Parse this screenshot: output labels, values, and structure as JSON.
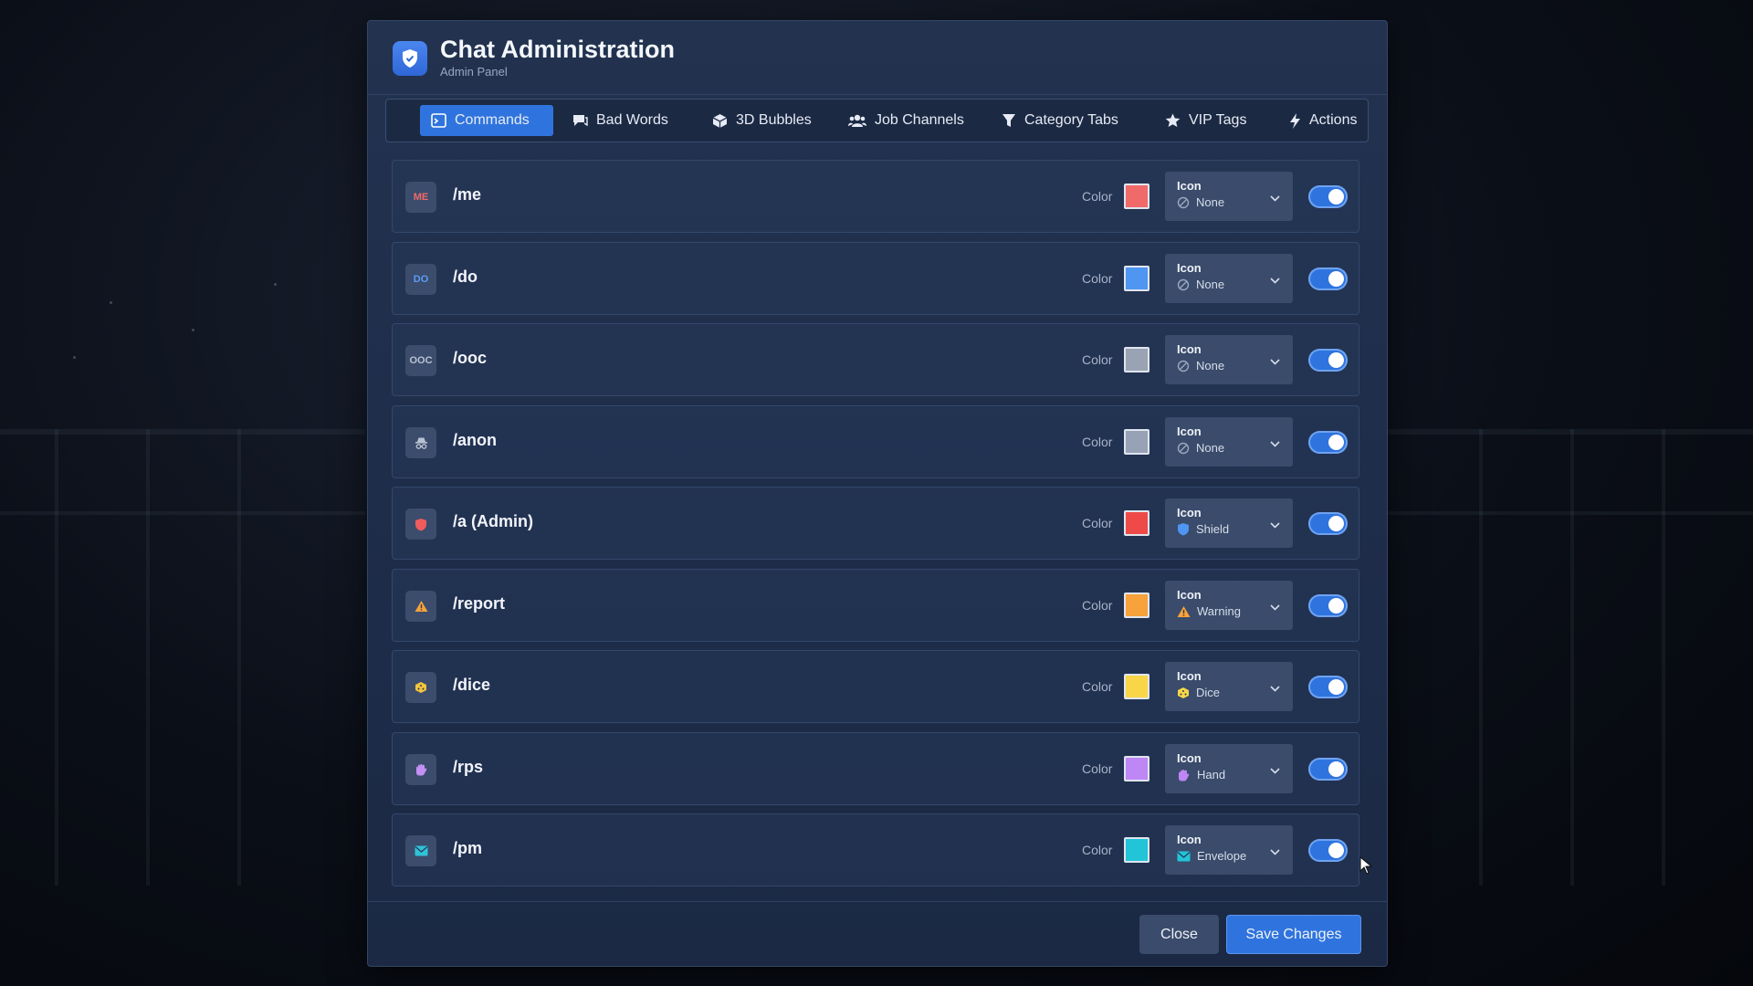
{
  "header": {
    "title": "Chat Administration",
    "subtitle": "Admin Panel"
  },
  "tabs": [
    {
      "label": "Commands",
      "icon": "terminal-icon",
      "active": true
    },
    {
      "label": "Bad Words",
      "icon": "chat-bubble-icon",
      "active": false
    },
    {
      "label": "3D Bubbles",
      "icon": "cube-icon",
      "active": false
    },
    {
      "label": "Job Channels",
      "icon": "users-icon",
      "active": false
    },
    {
      "label": "Category Tabs",
      "icon": "filter-icon",
      "active": false
    },
    {
      "label": "VIP Tags",
      "icon": "star-icon",
      "active": false
    },
    {
      "label": "Actions",
      "icon": "bolt-icon",
      "active": false
    }
  ],
  "labels": {
    "color": "Color",
    "icon": "Icon"
  },
  "commands": [
    {
      "badge": "ME",
      "badge_color": "#f06a6a",
      "name": "/me",
      "color": "#f06a6a",
      "icon_value": "None",
      "value_icon": "ban-icon",
      "enabled": true
    },
    {
      "badge": "DO",
      "badge_color": "#5b9bf5",
      "name": "/do",
      "color": "#4f95f2",
      "icon_value": "None",
      "value_icon": "ban-icon",
      "enabled": true
    },
    {
      "badge": "OOC",
      "badge_color": "#b9c2d2",
      "name": "/ooc",
      "color": "#9aa3b3",
      "icon_value": "None",
      "value_icon": "ban-icon",
      "enabled": true
    },
    {
      "badge": "",
      "badge_icon": "anon-icon",
      "badge_color": "#b9c2d2",
      "name": "/anon",
      "color": "#98a2b6",
      "icon_value": "None",
      "value_icon": "ban-icon",
      "enabled": true
    },
    {
      "badge": "",
      "badge_icon": "shield-icon",
      "badge_color": "#f05c5c",
      "name": "/a (Admin)",
      "color": "#ee4b48",
      "icon_value": "Shield",
      "value_icon": "shield-icon",
      "enabled": true
    },
    {
      "badge": "",
      "badge_icon": "warning-icon",
      "badge_color": "#f5a23a",
      "name": "/report",
      "color": "#f7a23a",
      "icon_value": "Warning",
      "value_icon": "warning-icon",
      "enabled": true
    },
    {
      "badge": "",
      "badge_icon": "dice-icon",
      "badge_color": "#f2c53d",
      "name": "/dice",
      "color": "#f9d648",
      "icon_value": "Dice",
      "value_icon": "dice-icon",
      "enabled": true
    },
    {
      "badge": "",
      "badge_icon": "hand-icon",
      "badge_color": "#c590f5",
      "name": "/rps",
      "color": "#bf86f6",
      "icon_value": "Hand",
      "value_icon": "hand-icon",
      "enabled": true
    },
    {
      "badge": "",
      "badge_icon": "envelope-icon",
      "badge_color": "#2fc3d8",
      "name": "/pm",
      "color": "#22c4d8",
      "icon_value": "Envelope",
      "value_icon": "envelope-icon",
      "enabled": true
    }
  ],
  "footer": {
    "close_label": "Close",
    "save_label": "Save Changes"
  }
}
